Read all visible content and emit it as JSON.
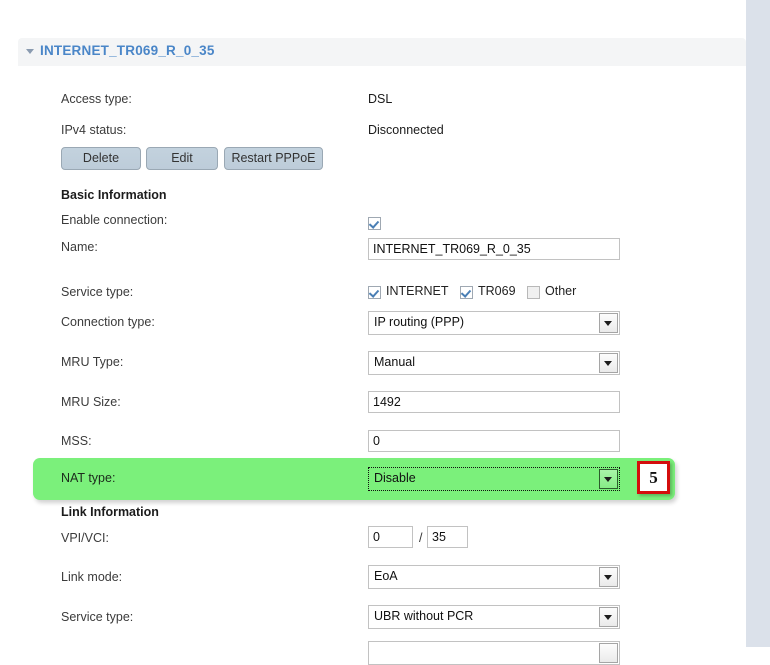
{
  "section": {
    "title": "INTERNET_TR069_R_0_35",
    "collapse_icon": "caret-down-icon"
  },
  "info": {
    "access_type_label": "Access type:",
    "access_type_value": "DSL",
    "ipv4_status_label": "IPv4 status:",
    "ipv4_status_value": "Disconnected"
  },
  "actions": {
    "delete": "Delete",
    "edit": "Edit",
    "restart": "Restart PPPoE"
  },
  "basic": {
    "heading": "Basic Information",
    "enable_connection_label": "Enable connection:",
    "enable_connection_checked": true,
    "name_label": "Name:",
    "name_value": "INTERNET_TR069_R_0_35",
    "service_type_label": "Service type:",
    "service_options": [
      {
        "label": "INTERNET",
        "checked": true
      },
      {
        "label": "TR069",
        "checked": true
      },
      {
        "label": "Other",
        "checked": false
      }
    ],
    "connection_type_label": "Connection type:",
    "connection_type_value": "IP routing (PPP)",
    "mru_type_label": "MRU Type:",
    "mru_type_value": "Manual",
    "mru_size_label": "MRU Size:",
    "mru_size_value": "1492",
    "mss_label": "MSS:",
    "mss_value": "0",
    "nat_type_label": "NAT type:",
    "nat_type_value": "Disable"
  },
  "link": {
    "heading": "Link Information",
    "vpi_vci_label": "VPI/VCI:",
    "vpi_value": "0",
    "vci_value": "35",
    "separator": "/",
    "link_mode_label": "Link mode:",
    "link_mode_value": "EoA",
    "service_type_label": "Service type:",
    "service_type_value": "UBR without PCR"
  },
  "callout": {
    "number": "5",
    "border_color": "#d40d0d"
  },
  "colors": {
    "highlight_green": "#7bf07b",
    "section_title_blue": "#4a86c8",
    "button_blue_gray": "#c3d2de",
    "header_bar_gray": "#f4f5f6",
    "right_strip": "#dbe1ea"
  }
}
